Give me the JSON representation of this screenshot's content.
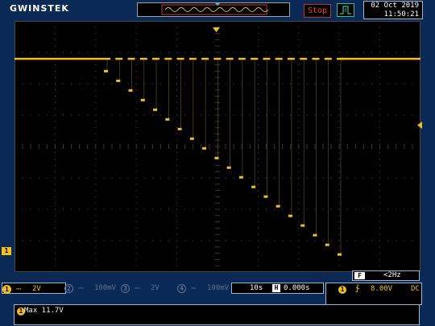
{
  "header": {
    "brand": "GWINSTEK",
    "run_status": "Stop",
    "date": "02 Oct 2019",
    "time": "11:50:21",
    "trigger_mode_icon": "edge-trigger-icon"
  },
  "colors": {
    "ch1": "#f0c020",
    "background": "#000000",
    "panel": "#0a2a55",
    "stop_red": "#ff3b3b",
    "inactive_channel": "#5f7190"
  },
  "waveform": {
    "baseline_fraction": 0.15,
    "step_count": 20,
    "step_first_fraction": 0.2,
    "step_last_fraction": 0.93
  },
  "channels": [
    {
      "num": "1",
      "coupling": "DC",
      "scale": "2V",
      "active": true
    },
    {
      "num": "2",
      "coupling": "DC",
      "scale": "100mV",
      "active": false
    },
    {
      "num": "3",
      "coupling": "DC",
      "scale": "2V",
      "active": false
    },
    {
      "num": "4",
      "coupling": "DC",
      "scale": "100mV",
      "active": false
    }
  ],
  "timebase": {
    "scale": "10s",
    "position_icon": "H",
    "position": "0.000s"
  },
  "frequency": {
    "icon": "F",
    "value": "<2Hz"
  },
  "trigger": {
    "source": "1",
    "slope_icon": "rising-edge-icon",
    "level": "8.00V",
    "coupling": "DC"
  },
  "measurement": {
    "channel": "1",
    "text": "Max 11.7V"
  },
  "markers": {
    "ch1_ground": "1"
  }
}
